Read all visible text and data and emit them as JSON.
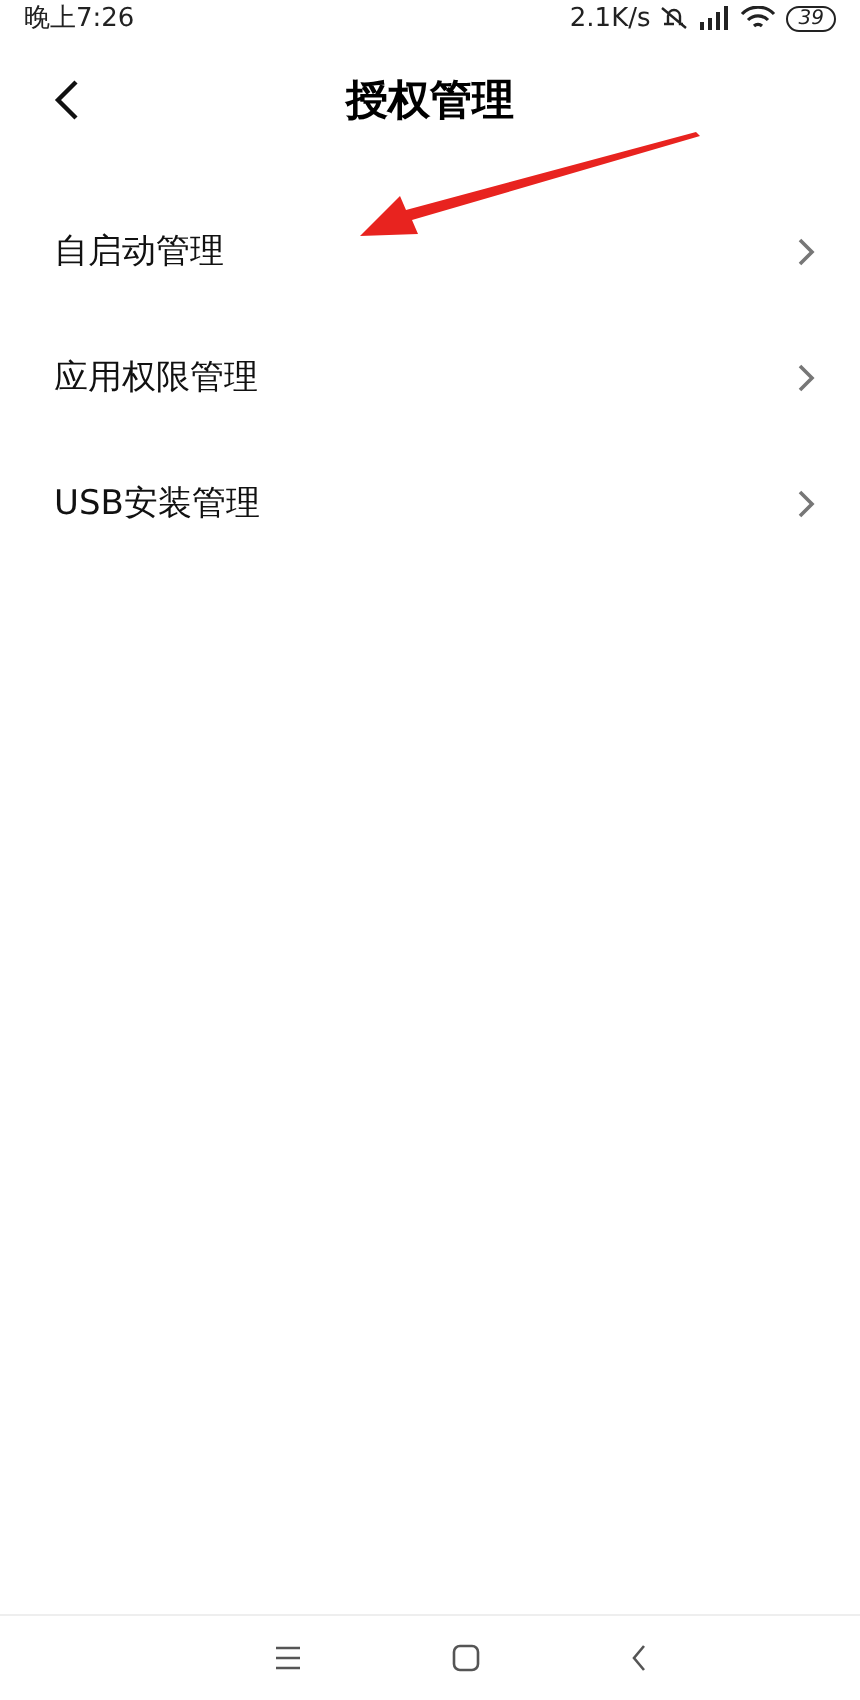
{
  "status_bar": {
    "time": "晚上7:26",
    "speed": "2.1K/s",
    "battery": "39"
  },
  "header": {
    "title": "授权管理"
  },
  "items": [
    {
      "label": "自启动管理"
    },
    {
      "label": "应用权限管理"
    },
    {
      "label": "USB安装管理"
    }
  ]
}
